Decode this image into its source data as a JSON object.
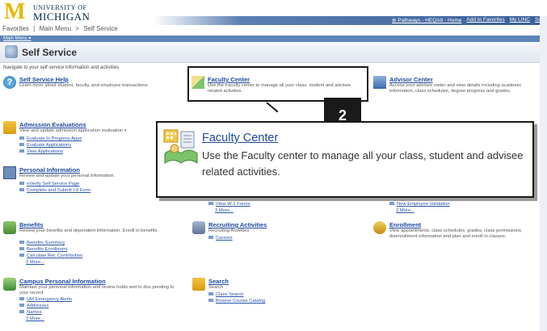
{
  "header": {
    "university_line1": "UNIVERSITY OF",
    "university_line2": "MICHIGAN",
    "top_links": [
      "⊕ Pathways - HEQA9 - Home",
      "Add to Favorites",
      "My LINC",
      "Sign"
    ]
  },
  "breadcrumbs": [
    "Favorites",
    "Main Menu",
    ">",
    "Self Service"
  ],
  "main_menu_label": "Main Menu ▾",
  "page_title": "Self Service",
  "nav_text": "Navigate to your self service information and activities.",
  "cells": {
    "ss_help": {
      "title": "Self Service Help",
      "desc": "Learn more about student, faculty, and employee transactions."
    },
    "faculty_center": {
      "title": "Faculty Center",
      "desc": "Use the Faculty center to manage all your class, student and advisee related activities."
    },
    "advisor_center": {
      "title": "Advisor Center",
      "desc": "Access your advisee roster and view details including academic information, class schedules, degree progress and grades."
    },
    "admission": {
      "title": "Admission Evaluations",
      "desc": "View and update admission application evaluation s",
      "links": [
        "Evaluate In Progress Apps",
        "Evaluate Applications",
        "View Applications"
      ]
    },
    "personal": {
      "title": "Personal Information",
      "desc": "Review and update your personal information.",
      "links": [
        "eVerify Self Service Page",
        "Complete and Submit I-9 Form"
      ]
    },
    "mid_links": [
      "View W-2 Forms",
      "3 More..."
    ],
    "right_links": [
      "New Employee Validation",
      "2 More..."
    ],
    "benefits": {
      "title": "Benefits",
      "desc": "Review your benefits and dependent information. Enroll in benefits.",
      "links": [
        "Benefits Summary",
        "Benefits Enrollment",
        "Calculate Ret. Contribution"
      ],
      "more": "3 More..."
    },
    "recruiting": {
      "title": "Recruiting Activities",
      "desc": "Recruiting Activities",
      "links": [
        "Careers"
      ]
    },
    "enrollment": {
      "title": "Enrollment",
      "desc": "View appointments, class schedules, grades, class permissions, disenrollment information and plan and enroll in classes."
    },
    "campus_personal": {
      "title": "Campus Personal Information",
      "desc": "Maintain your personal information and review holds and to dos pending to your record.",
      "links": [
        "UM Emergency Alerts",
        "Addresses",
        "Names"
      ],
      "more": "3 More..."
    },
    "search": {
      "title": "Search",
      "desc": "Search",
      "links": [
        "Class Search",
        "Browse Course Catalog"
      ]
    }
  },
  "callout": {
    "step_number": "2",
    "title": "Faculty Center",
    "desc": "Use the Faculty center to manage all your class, student and advisee related activities."
  },
  "colors": {
    "link": "#1e4aa0",
    "header_bar": "#5d84b7",
    "callout_border": "#1a1a1a",
    "logo_maize": "#e8b900",
    "logo_blue": "#00274c"
  }
}
